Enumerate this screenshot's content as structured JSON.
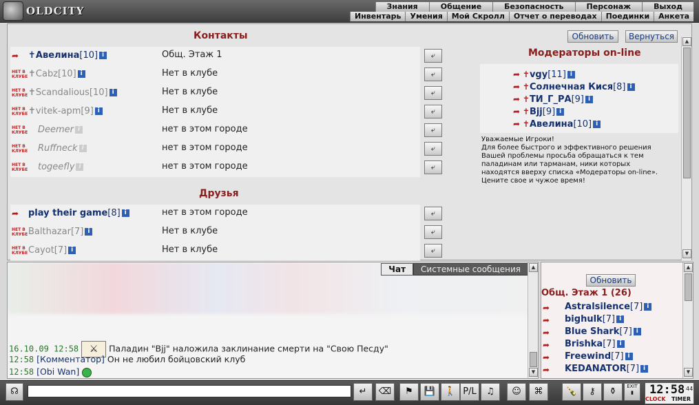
{
  "app": {
    "logo_text": "OLDCITY"
  },
  "top_nav": {
    "row1": [
      "Знания",
      "Общение",
      "Безопасность",
      "Персонаж",
      "Выход"
    ],
    "row2": [
      "Инвентарь",
      "Умения",
      "Мой Скролл",
      "Отчет о переводах",
      "Поединки",
      "Анкета"
    ]
  },
  "contacts": {
    "title": "Контакты",
    "refresh_label": "Обновить",
    "back_label": "Вернуться",
    "items": [
      {
        "icon": "arrow-icon",
        "cross": "✝",
        "name": "Авелина",
        "level": "[10]",
        "location": "Общ. Этаж 1",
        "state": "online"
      },
      {
        "icon": "status-icon",
        "cross": "✝",
        "name": "Cabz",
        "level": "[10]",
        "location": "Нет в клубе",
        "state": "offline"
      },
      {
        "icon": "status-icon",
        "cross": "✝",
        "name": "Scandalious",
        "level": "[10]",
        "location": "Нет в клубе",
        "state": "offline"
      },
      {
        "icon": "status-icon",
        "cross": "✝",
        "name": "vitek-apm",
        "level": "[9]",
        "location": "Нет в клубе",
        "state": "offline"
      },
      {
        "icon": "status-icon",
        "cross": "",
        "name": "Deemer",
        "level": "",
        "location": "нет в этом городе",
        "state": "ghost"
      },
      {
        "icon": "status-icon",
        "cross": "",
        "name": "Ruffneck",
        "level": "",
        "location": "нет в этом городе",
        "state": "ghost"
      },
      {
        "icon": "status-icon",
        "cross": "",
        "name": "togeefly",
        "level": "",
        "location": "нет в этом городе",
        "state": "ghost"
      }
    ]
  },
  "friends": {
    "title": "Друзья",
    "items": [
      {
        "icon": "arrow-icon",
        "cross": "",
        "name": "play their game",
        "level": "[8]",
        "location": "нет в этом городе",
        "state": "online"
      },
      {
        "icon": "status-icon",
        "cross": "",
        "name": "Balthazar",
        "level": "[7]",
        "location": "Нет в клубе",
        "state": "offline"
      },
      {
        "icon": "status-icon",
        "cross": "",
        "name": "Cayot",
        "level": "[7]",
        "location": "Нет в клубе",
        "state": "offline"
      }
    ]
  },
  "status_icon_text": "НЕТ В КЛУБЕ",
  "moderators": {
    "title": "Модераторы on-line",
    "items": [
      {
        "name": "vgy",
        "level": "[11]"
      },
      {
        "name": "Солнечная Кися",
        "level": "[8]"
      },
      {
        "name": "ТИ_Г_РА",
        "level": "[9]"
      },
      {
        "name": "Bjj",
        "level": "[9]"
      },
      {
        "name": "Авелина",
        "level": "[10]"
      }
    ],
    "notice": [
      "Уважаемые Игроки!",
      "Для более быстрого и эффективного решения",
      "Вашей проблемы просьба обращаться к тем",
      "паладинам или тарманам, ники которых",
      "находятся вверху списка «Модераторы on-line».",
      "Цените свое и чужое время!"
    ]
  },
  "chat": {
    "tabs": [
      "Чат",
      "Системные сообщения"
    ],
    "messages": [
      {
        "time": "16.10.09 12:58",
        "user": "",
        "text": "Паладин \"Bjj\" наложила заклинание смерти на \"Свою Песду\""
      },
      {
        "time": "12:58",
        "user": "[Комментатор]",
        "text": "Он не любил бойцовский клуб"
      },
      {
        "time": "12:58",
        "user": "[Obi Wan]",
        "text": ""
      }
    ]
  },
  "online": {
    "refresh_label": "Обновить",
    "room_title": "Общ. Этаж 1 (26)",
    "items": [
      {
        "name": "Astralsilence",
        "level": "[7]"
      },
      {
        "name": "bighulk",
        "level": "[7]"
      },
      {
        "name": "Blue Shark",
        "level": "[7]"
      },
      {
        "name": "Brishka",
        "level": "[7]"
      },
      {
        "name": "Freewind",
        "level": "[7]"
      },
      {
        "name": "KEDANATOR",
        "level": "[7]"
      }
    ]
  },
  "bottom": {
    "clock_time": "12:58",
    "clock_seconds": "44",
    "clock_label": "CLOCK",
    "timer_label": "TIMER",
    "exit_label": "EXIT",
    "toolbar_icons": [
      "send-icon",
      "eraser-icon",
      "filter-icon",
      "save-icon",
      "walk-icon",
      "translit-icon",
      "music-icon",
      "smiley-icon",
      "map-icon",
      "bottle-icon",
      "keys-icon",
      "bag-icon",
      "exit-icon"
    ]
  },
  "colors": {
    "accent_red": "#8a1c1c",
    "link_blue": "#14306e",
    "time_green": "#237a23"
  }
}
